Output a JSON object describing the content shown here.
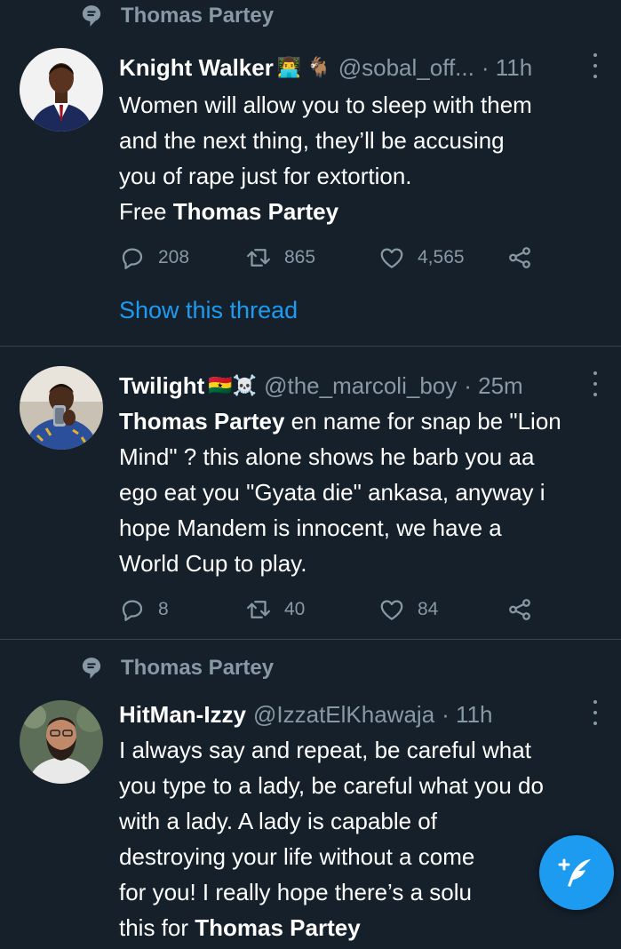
{
  "topic_1": "Thomas Partey",
  "topic_2": "Thomas Partey",
  "tweets": [
    {
      "name": "Knight Walker",
      "emoji": "👨‍💻 🐐",
      "handle": "@sobal_off...",
      "time": "· 11h",
      "lines": [
        "Women will allow you to sleep with them",
        "and the next thing, they’ll be accusing",
        "you of rape just for extortion."
      ],
      "line4_prefix": "Free ",
      "line4_bold": "Thomas Partey",
      "replies": "208",
      "retweets": "865",
      "likes": "4,565",
      "show_thread": "Show this thread"
    },
    {
      "name": "Twilight",
      "emoji": "🇬🇭☠️",
      "handle": "@the_marcoli_boy",
      "time": "· 25m",
      "line1_bold": "Thomas Partey",
      "line1_rest": " en name for snap be \"Lion",
      "lines": [
        "Mind\" ? this alone shows he barb you aa",
        "ego eat you \"Gyata die\" ankasa, anyway i",
        "hope Mandem is innocent, we have a",
        "World Cup to play."
      ],
      "replies": "8",
      "retweets": "40",
      "likes": "84"
    },
    {
      "name": "HitMan-Izzy",
      "handle": "@IzzatElKhawaja",
      "time": "· 11h",
      "lines": [
        "I always say and repeat, be careful what",
        "you type to a lady, be careful what you do",
        "with a lady. A lady is capable of",
        "destroying your life without a come",
        "for you! I really hope there’s a solu"
      ],
      "line6_prefix": "this for ",
      "line6_bold": "Thomas Partey"
    }
  ],
  "colors": {
    "background": "#15202b",
    "accent": "#1d9bf0",
    "muted": "#8899a6",
    "divider": "#38444d"
  },
  "icons": [
    "topic-icon",
    "reply-icon",
    "retweet-icon",
    "like-icon",
    "share-icon",
    "more-icon",
    "compose-icon"
  ]
}
